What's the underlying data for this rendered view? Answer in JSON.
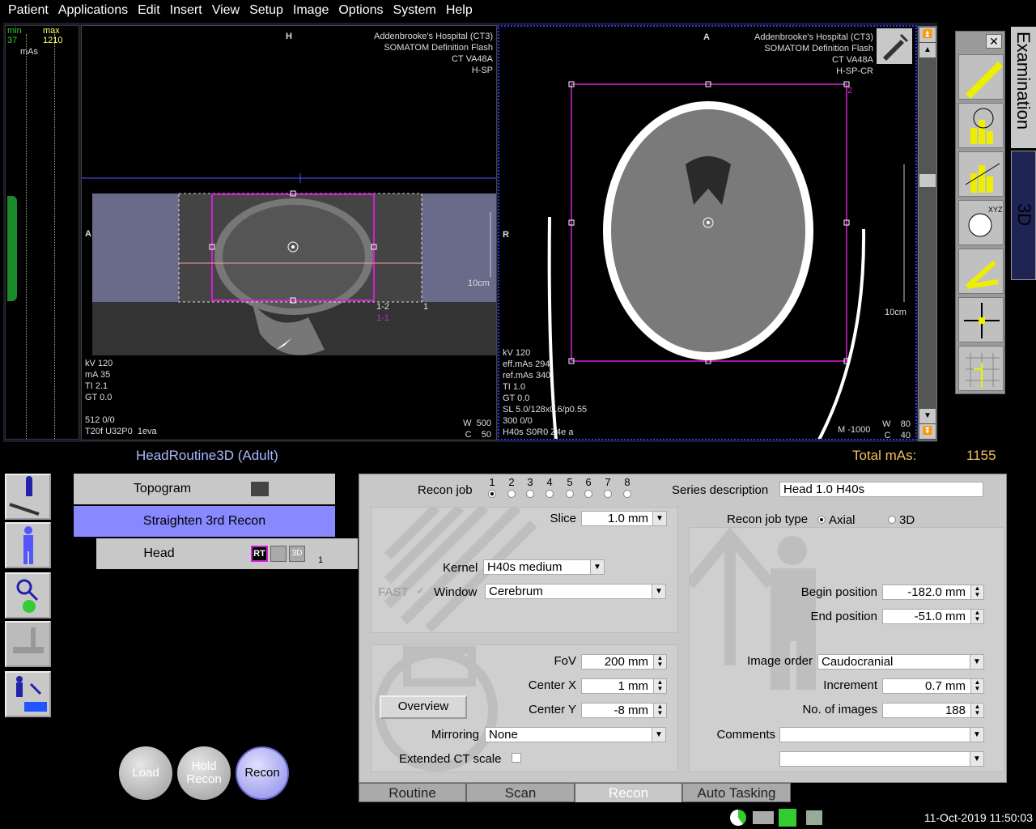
{
  "menu": [
    "Patient",
    "Applications",
    "Edit",
    "Insert",
    "View",
    "Setup",
    "Image",
    "Options",
    "System",
    "Help"
  ],
  "mas_panel": {
    "min_label": "min",
    "min_val": "37",
    "max_label": "max",
    "max_val": "1210",
    "unit": "mAs"
  },
  "seg_left": {
    "orient_top": "H",
    "orient_left": "A",
    "hospital": "Addenbrooke's Hospital (CT3)\nSOMATOM Definition Flash\nCT VA48A\nH-SP",
    "info": "kV 120\nmA 35\nTI 2.1\nGT 0.0",
    "bottom": "512 0/0\nT20f U32P0  1eva",
    "wc": "W  500\nC    50",
    "scale": "10cm",
    "range_a": "1-2",
    "range_b": "1-1",
    "range_c": "1"
  },
  "seg_right": {
    "orient_top": "A",
    "orient_left": "R",
    "hospital": "Addenbrooke's Hospital (CT3)\nSOMATOM Definition Flash\nCT VA48A\nH-SP-CR",
    "info": "kV 120\neff.mAs 294\nref.mAs 340\nTI 1.0\nGT 0.0\nSL 5.0/128x0.6/p0.55\n300 0/0\nH40s S0R0 Z4e a",
    "wc": "W    80\nC    40",
    "m": "M -1000",
    "scale": "10cm",
    "box_num": "2"
  },
  "protocol": {
    "title": "HeadRoutine3D (Adult)",
    "total_label": "Total mAs:",
    "total_value": "1155"
  },
  "tree": {
    "topogram": "Topogram",
    "straighten": "Straighten 3rd Recon",
    "head": "Head",
    "rt": "RT",
    "td": "3D",
    "count": "1"
  },
  "buttons": {
    "load": "Load",
    "hold1": "Hold",
    "hold2": "Recon",
    "recon": "Recon"
  },
  "recon": {
    "recon_job_label": "Recon job",
    "jobs": [
      "1",
      "2",
      "3",
      "4",
      "5",
      "6",
      "7",
      "8"
    ],
    "series_label": "Series description",
    "series_value": "Head  1.0  H40s",
    "slice_label": "Slice",
    "slice_value": "1.0 mm",
    "kernel_label": "Kernel",
    "kernel_value": "H40s medium",
    "fast_label": "FAST",
    "window_label": "Window",
    "window_value": "Cerebrum",
    "recon_type_label": "Recon job type",
    "axial": "Axial",
    "threed": "3D",
    "begin_label": "Begin position",
    "begin_value": "-182.0 mm",
    "end_label": "End position",
    "end_value": "-51.0 mm",
    "fov_label": "FoV",
    "fov_value": "200 mm",
    "cx_label": "Center X",
    "cx_value": "1 mm",
    "cy_label": "Center Y",
    "cy_value": "-8 mm",
    "overview": "Overview",
    "mirroring_label": "Mirroring",
    "mirroring_value": "None",
    "extended_label": "Extended CT scale",
    "order_label": "Image order",
    "order_value": "Caudocranial",
    "incr_label": "Increment",
    "incr_value": "0.7 mm",
    "noimg_label": "No. of images",
    "noimg_value": "188",
    "comments_label": "Comments"
  },
  "tabs": [
    "Routine",
    "Scan",
    "Recon",
    "Auto Tasking"
  ],
  "side_tabs": {
    "exam": "Examination",
    "threed": "3D"
  },
  "clock": "11-Oct-2019 11:50:03"
}
